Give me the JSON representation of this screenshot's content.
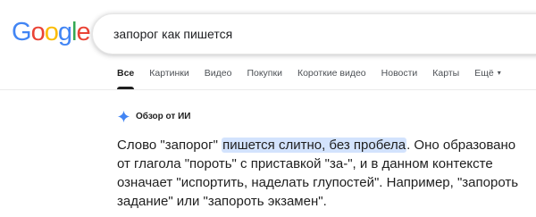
{
  "logo": {
    "letters": [
      "G",
      "o",
      "o",
      "g",
      "l",
      "e"
    ],
    "colors": [
      "#4285F4",
      "#EA4335",
      "#FBBC05",
      "#4285F4",
      "#34A853",
      "#EA4335"
    ]
  },
  "search": {
    "query": "запорог как пишется"
  },
  "tabs": [
    {
      "label": "Все",
      "active": true
    },
    {
      "label": "Картинки"
    },
    {
      "label": "Видео"
    },
    {
      "label": "Покупки"
    },
    {
      "label": "Короткие видео"
    },
    {
      "label": "Новости"
    },
    {
      "label": "Карты"
    },
    {
      "label": "Ещё"
    }
  ],
  "ai_overview": {
    "icon": "sparkle-icon",
    "title": "Обзор от ИИ",
    "text_before": "Слово \"запорог\" ",
    "text_highlight": "пишется слитно, без пробела",
    "text_after": ". Оно образовано от глагола \"пороть\" с приставкой \"за-\", и в данном контексте означает \"испортить, наделать глупостей\". Например, \"запороть задание\" или \"запороть экзамен\"."
  },
  "colors": {
    "highlight": "#d3e3fd",
    "sparkle": "#4285F4"
  }
}
